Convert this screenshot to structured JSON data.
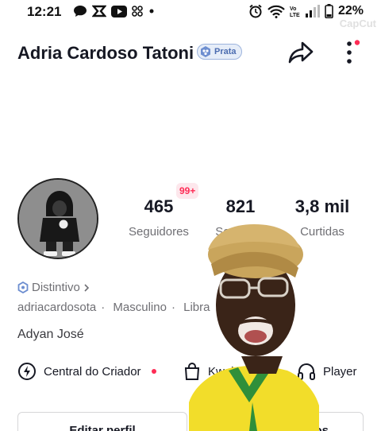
{
  "status_bar": {
    "time": "12:21",
    "battery": "22%",
    "left_icons": [
      "chat-bubble-icon",
      "capcut-icon",
      "youtube-icon",
      "app-grid-icon",
      "dot-icon"
    ],
    "right_icons": [
      "alarm-icon",
      "wifi-icon",
      "volte-icon",
      "signal-icon",
      "battery-icon"
    ],
    "watermark": "CapCut"
  },
  "profile": {
    "display_name": "Adria Cardoso Tatoni",
    "badge": "Prata",
    "notification_count": "99+",
    "stats": [
      {
        "value": "465",
        "label": "Seguidores"
      },
      {
        "value": "821",
        "label": "Seguindo"
      },
      {
        "value": "3,8 mil",
        "label": "Curtidas"
      }
    ],
    "distintivo": "Distintivo",
    "meta": [
      "adriacardosota",
      "Masculino",
      "Libra"
    ],
    "bio": "Adyan José"
  },
  "quick_links": [
    {
      "label": "Central do Criador",
      "icon": "lightning-icon"
    },
    {
      "label": "Kwai Shop",
      "icon": "shopping-bag-icon"
    },
    {
      "label": "Player",
      "icon": "headphones-icon"
    }
  ],
  "buttons": {
    "edit_profile": "Editar perfil",
    "add_friends": "Adicionar amigos"
  },
  "colors": {
    "accent": "#fe2c55",
    "text": "#161823",
    "muted": "#6f6f74",
    "badge_blue": "#4b6cb0"
  }
}
